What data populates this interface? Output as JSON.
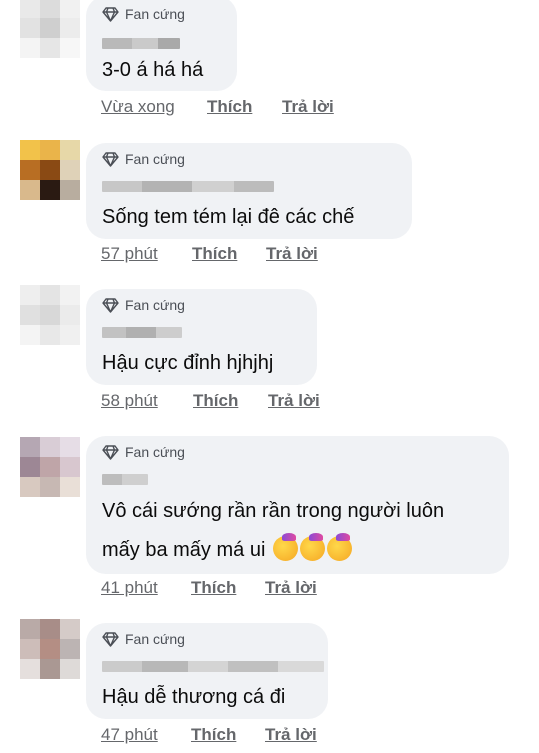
{
  "badge_label": "Fan cứng",
  "like_label": "Thích",
  "reply_label": "Trả lời",
  "comments": [
    {
      "text": [
        "3-0 á há há"
      ],
      "time": "Vừa xong"
    },
    {
      "text": [
        "Sống tem tém lại đê các chế"
      ],
      "time": "57 phút"
    },
    {
      "text": [
        "Hậu cực đỉnh hjhjhj"
      ],
      "time": "58 phút"
    },
    {
      "text": [
        "Vô cái sướng rần rần trong người luôn",
        "mấy ba mấy má ui"
      ],
      "time": "41 phút",
      "emoji": [
        "smiling-face-with-party-hat",
        "smiling-face-with-party-hat",
        "smiling-face-with-party-hat"
      ]
    },
    {
      "text": [
        "Hậu dễ thương cá đi"
      ],
      "time": "47 phút"
    }
  ]
}
